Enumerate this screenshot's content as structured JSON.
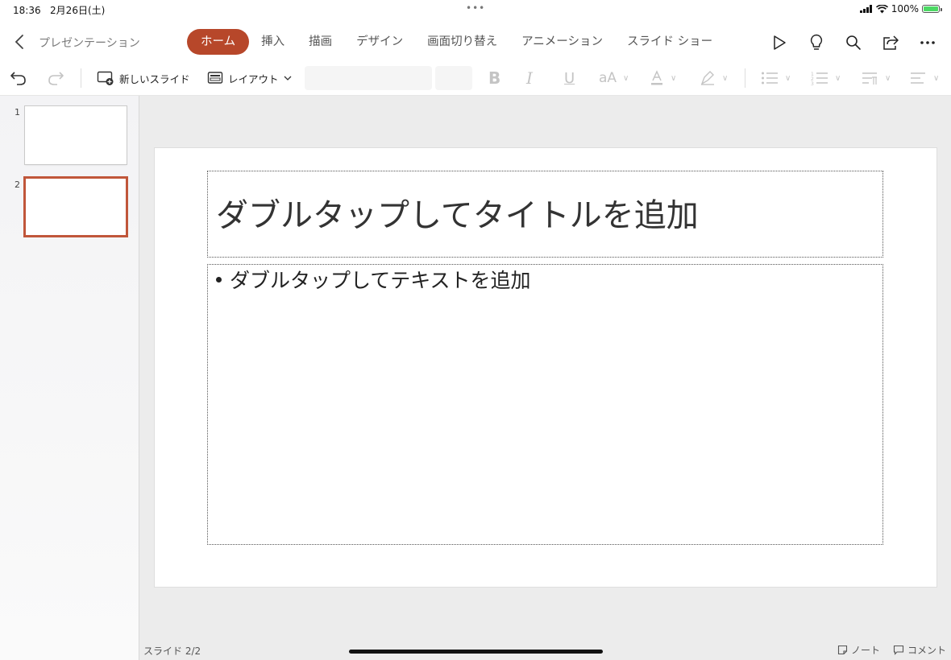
{
  "status_bar": {
    "time": "18:36",
    "date": "2月26日(土)",
    "dots": "•••",
    "battery_label": "100%",
    "battery_level": 1.0
  },
  "header": {
    "title": "プレゼンテーション",
    "tabs": [
      {
        "label": "ホーム",
        "active": true
      },
      {
        "label": "挿入"
      },
      {
        "label": "描画"
      },
      {
        "label": "デザイン"
      },
      {
        "label": "画面切り替え"
      },
      {
        "label": "アニメーション"
      },
      {
        "label": "スライド ショー"
      }
    ],
    "actions": [
      "play-icon",
      "lightbulb-icon",
      "search-icon",
      "share-icon",
      "more-icon"
    ]
  },
  "toolbar": {
    "new_slide": "新しいスライド",
    "layout": "レイアウト",
    "font_name": "",
    "font_size": ""
  },
  "thumbnails": [
    {
      "number": "1",
      "selected": false
    },
    {
      "number": "2",
      "selected": true
    }
  ],
  "slide": {
    "title_placeholder": "ダブルタップしてタイトルを追加",
    "body_placeholder": "ダブルタップしてテキストを追加"
  },
  "footer": {
    "slide_counter": "スライド 2/2",
    "notes": "ノート",
    "comments": "コメント"
  },
  "colors": {
    "accent": "#b7472a",
    "thumb_selected_border": "#c0563a",
    "battery": "#4cd964"
  }
}
